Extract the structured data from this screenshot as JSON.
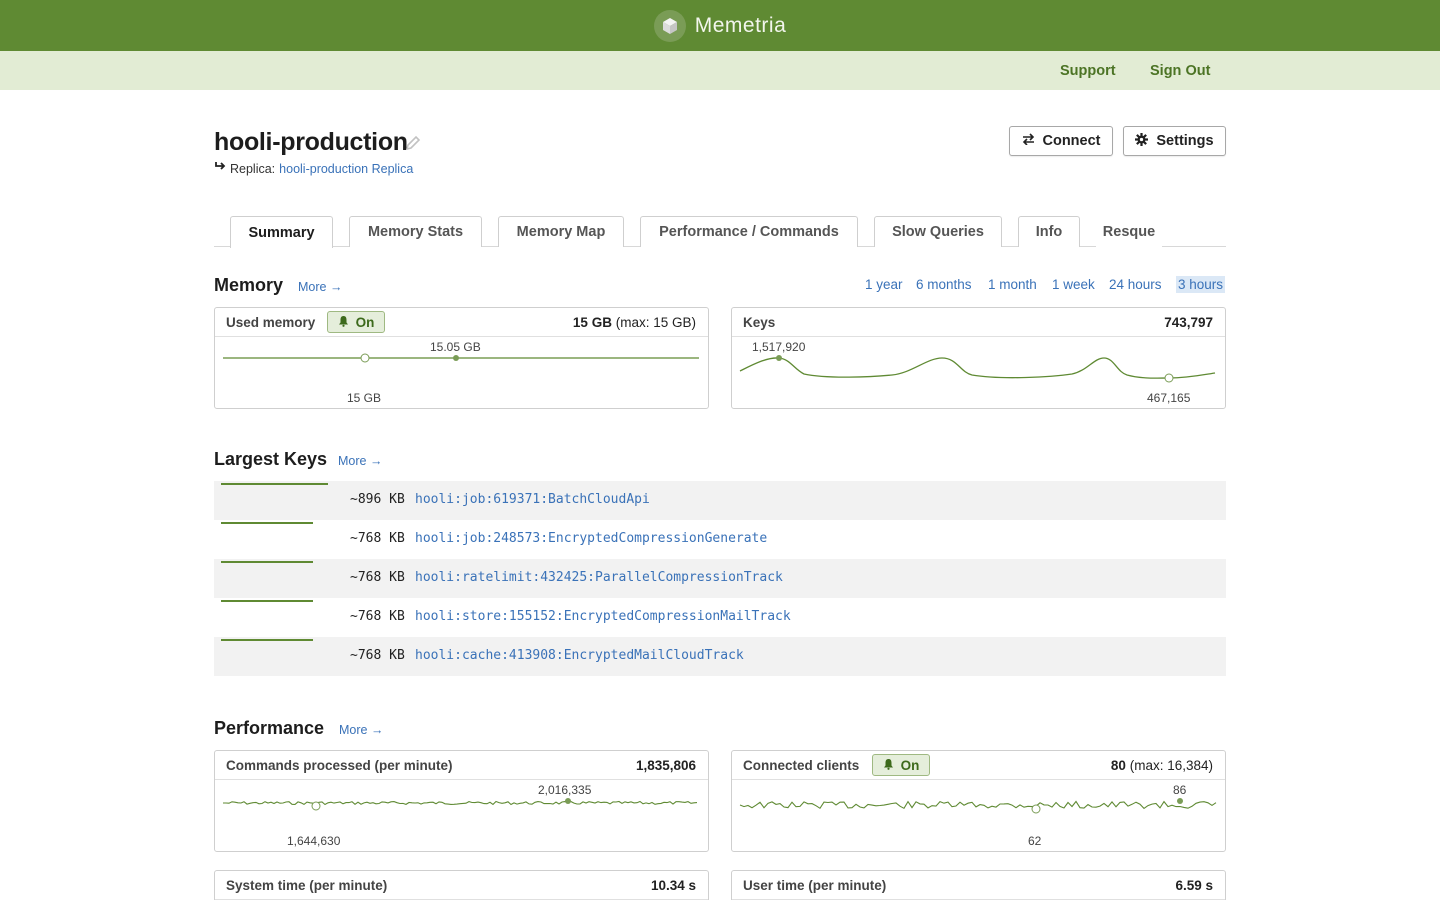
{
  "app": {
    "name": "Memetria"
  },
  "nav": {
    "support": "Support",
    "sign_out": "Sign Out"
  },
  "instance": {
    "title": "hooli-production",
    "replica_label": "Replica:",
    "replica_link": "hooli-production Replica",
    "connect": "Connect",
    "settings": "Settings"
  },
  "tabs": [
    "Summary",
    "Memory Stats",
    "Memory Map",
    "Performance / Commands",
    "Slow Queries",
    "Info",
    "Resque"
  ],
  "memory": {
    "heading": "Memory",
    "more": "More →",
    "ranges": [
      "1 year",
      "6 months",
      "1 month",
      "1 week",
      "24 hours",
      "3 hours"
    ],
    "active_range": "3 hours",
    "used": {
      "label": "Used memory",
      "alert": "On",
      "value": "15 GB",
      "value_suffix": "(max: 15 GB)",
      "max_label": "15.05 GB",
      "min_label": "15 GB"
    },
    "keys": {
      "label": "Keys",
      "value": "743,797",
      "max_label": "1,517,920",
      "min_label": "467,165"
    }
  },
  "largest_keys": {
    "heading": "Largest Keys",
    "more": "More →",
    "rows": [
      {
        "size": "~896 KB",
        "name": "hooli:job:619371:BatchCloudApi",
        "fraction": 1.0
      },
      {
        "size": "~768 KB",
        "name": "hooli:job:248573:EncryptedCompressionGenerate",
        "fraction": 0.857
      },
      {
        "size": "~768 KB",
        "name": "hooli:ratelimit:432425:ParallelCompressionTrack",
        "fraction": 0.857
      },
      {
        "size": "~768 KB",
        "name": "hooli:store:155152:EncryptedCompressionMailTrack",
        "fraction": 0.857
      },
      {
        "size": "~768 KB",
        "name": "hooli:cache:413908:EncryptedMailCloudTrack",
        "fraction": 0.857
      }
    ]
  },
  "performance": {
    "heading": "Performance",
    "more": "More →",
    "commands": {
      "label": "Commands processed (per minute)",
      "value": "1,835,806",
      "max_label": "2,016,335",
      "min_label": "1,644,630"
    },
    "clients": {
      "label": "Connected clients",
      "alert": "On",
      "value": "80",
      "value_suffix": "(max: 16,384)",
      "max_label": "86",
      "min_label": "62"
    },
    "system_time": {
      "label": "System time (per minute)",
      "value": "10.34 s"
    },
    "user_time": {
      "label": "User time (per minute)",
      "value": "6.59 s"
    }
  },
  "colors": {
    "brand": "#5f8a33",
    "subbar": "#e2ecd4",
    "link": "#3a72b8",
    "line": "#5f8a33"
  },
  "icons": [
    "cube-icon",
    "pencil-icon",
    "replica-arrow-icon",
    "swap-arrows-icon",
    "gear-icon",
    "bell-icon",
    "arrow-right-icon"
  ]
}
